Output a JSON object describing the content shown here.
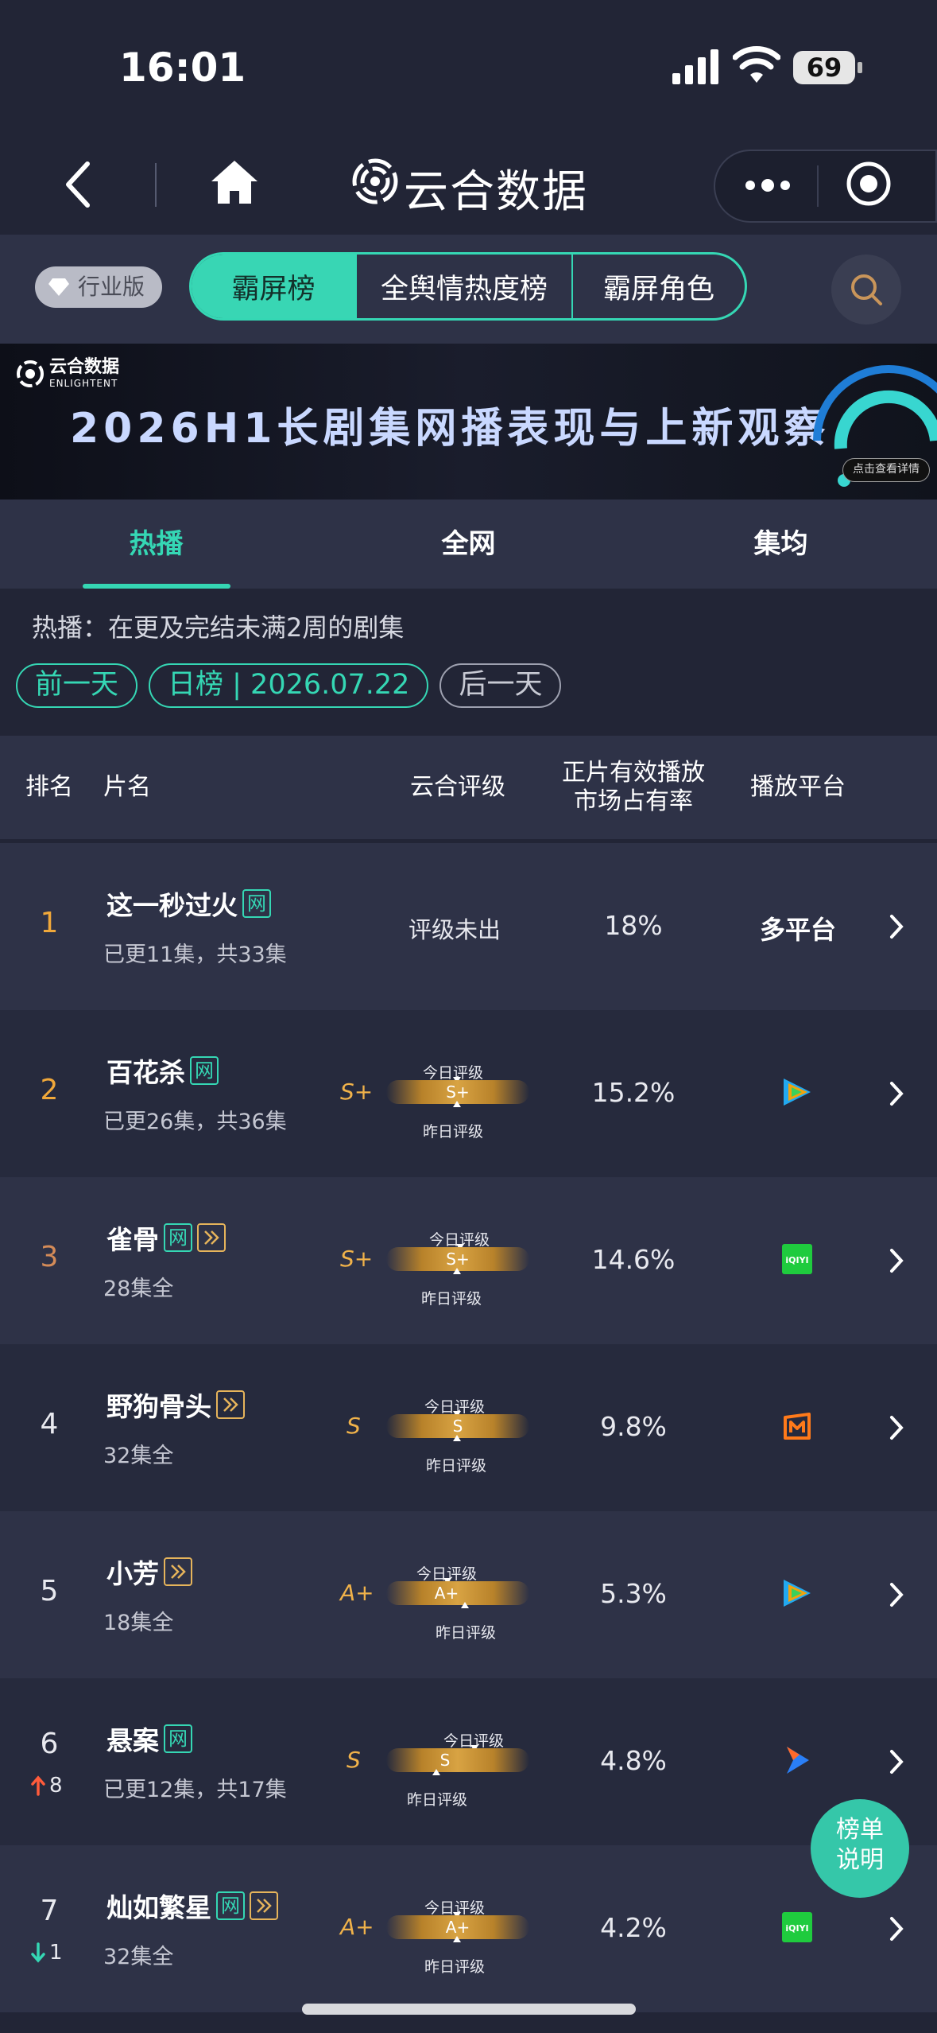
{
  "status_bar": {
    "time": "16:01",
    "battery": "69"
  },
  "header": {
    "app_title": "云合数据"
  },
  "top_bar": {
    "badge": "行业版",
    "segments": [
      "霸屏榜",
      "全舆情热度榜",
      "霸屏角色"
    ],
    "active_segment": "霸屏榜"
  },
  "banner": {
    "brand": "云合数据",
    "brand_en": "ENLIGHTENT",
    "title": "2026H1长剧集网播表现与上新观察",
    "cta": "点击查看详情"
  },
  "sub_tabs": [
    "热播",
    "全网",
    "集均"
  ],
  "description": "热播：在更及完结未满2周的剧集",
  "date_row": {
    "prev": "前一天",
    "current": "日榜 | 2026.07.22",
    "next": "后一天"
  },
  "table_header": {
    "rank": "排名",
    "title": "片名",
    "rating": "云合评级",
    "share": "正片有效播放\n市场占有率",
    "platform": "播放平台"
  },
  "rating_labels": {
    "today": "今日评级",
    "yesterday": "昨日评级"
  },
  "rows": [
    {
      "rank": "1",
      "name": "这一秒过火",
      "tags": [
        "网"
      ],
      "episodes": "已更11集，共33集",
      "rating": "评级未出",
      "share": "18%",
      "platform": "多平台"
    },
    {
      "rank": "2",
      "name": "百花杀",
      "tags": [
        "网"
      ],
      "episodes": "已更26集，共36集",
      "grade": "S+",
      "gauge": "S+",
      "share": "15.2%",
      "platform_icon": "tencent-video-icon"
    },
    {
      "rank": "3",
      "name": "雀骨",
      "tags": [
        "网",
        "play"
      ],
      "episodes": "28集全",
      "grade": "S+",
      "gauge": "S+",
      "share": "14.6%",
      "platform_icon": "iqiyi-icon",
      "platform_icon_text": "iQIYI"
    },
    {
      "rank": "4",
      "name": "野狗骨头",
      "tags": [
        "play"
      ],
      "episodes": "32集全",
      "grade": "S",
      "gauge": "S",
      "share": "9.8%",
      "platform_icon": "mango-tv-icon"
    },
    {
      "rank": "5",
      "name": "小芳",
      "tags": [
        "play"
      ],
      "episodes": "18集全",
      "grade": "A+",
      "gauge": "A+",
      "share": "5.3%",
      "platform_icon": "tencent-video-icon"
    },
    {
      "rank": "6",
      "change": "8",
      "change_dir": "up",
      "name": "悬案",
      "tags": [
        "网"
      ],
      "episodes": "已更12集，共17集",
      "grade": "S",
      "gauge": "S",
      "share": "4.8%",
      "platform_icon": "youku-icon"
    },
    {
      "rank": "7",
      "change": "1",
      "change_dir": "down",
      "name": "灿如繁星",
      "tags": [
        "网",
        "play"
      ],
      "episodes": "32集全",
      "grade": "A+",
      "gauge": "A+",
      "share": "4.2%",
      "platform_icon": "iqiyi-icon",
      "platform_icon_text": "iQIYI"
    }
  ],
  "fab": {
    "line1": "榜单",
    "line2": "说明"
  },
  "colors": {
    "accent": "#35d7b4",
    "gold": "#f0b24a",
    "bg": "#222536"
  }
}
